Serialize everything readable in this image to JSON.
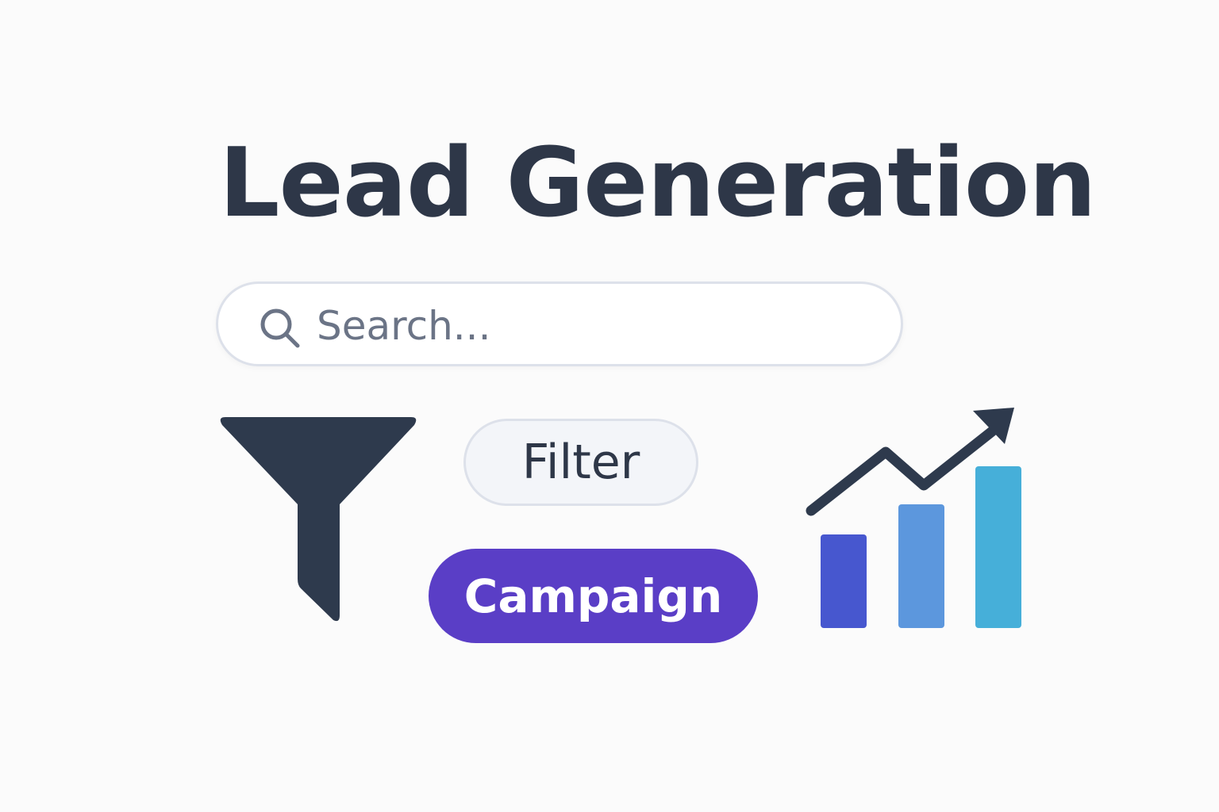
{
  "title": "Lead Generation",
  "search": {
    "placeholder": "Search...",
    "icon": "search-icon"
  },
  "buttons": {
    "filter_label": "Filter",
    "campaign_label": "Campaign"
  },
  "icons": {
    "funnel": "funnel-icon",
    "growth_chart": "growth-chart-icon"
  },
  "colors": {
    "text_dark": "#2e3748",
    "campaign_bg": "#5a3ec6",
    "bar_1": "#4757cf",
    "bar_2": "#5c97dd",
    "bar_3": "#46afd9"
  }
}
